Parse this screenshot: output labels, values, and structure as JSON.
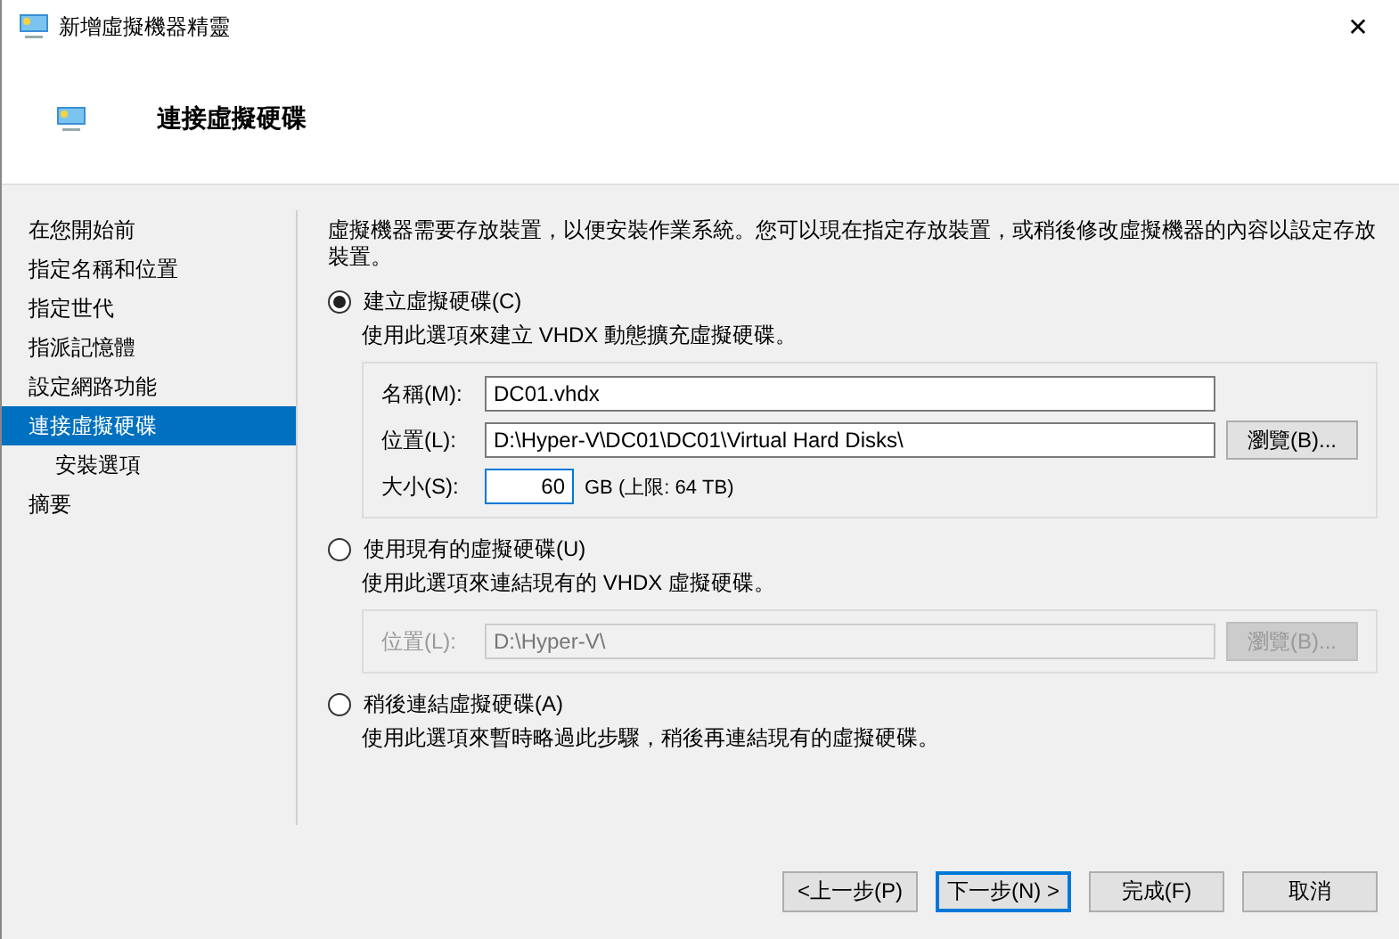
{
  "window": {
    "title": "新增虛擬機器精靈",
    "close": "✕"
  },
  "header": {
    "title": "連接虛擬硬碟"
  },
  "sidebar": {
    "items": [
      {
        "label": "在您開始前",
        "selected": false
      },
      {
        "label": "指定名稱和位置",
        "selected": false
      },
      {
        "label": "指定世代",
        "selected": false
      },
      {
        "label": "指派記憶體",
        "selected": false
      },
      {
        "label": "設定網路功能",
        "selected": false
      },
      {
        "label": "連接虛擬硬碟",
        "selected": true,
        "children": [
          {
            "label": "安裝選項",
            "selected": false
          }
        ]
      },
      {
        "label": "摘要",
        "selected": false
      }
    ]
  },
  "intro": "虛擬機器需要存放裝置，以便安裝作業系統。您可以現在指定存放裝置，或稍後修改虛擬機器的內容以設定存放裝置。",
  "options": [
    {
      "label": "建立虛擬硬碟(C)",
      "selected": true,
      "description": "使用此選項來建立 VHDX 動態擴充虛擬硬碟。",
      "group": {
        "disabled": false,
        "fields": [
          {
            "kind": "text",
            "label": "名稱(M):",
            "value": "DC01.vhdx"
          },
          {
            "kind": "path",
            "label": "位置(L):",
            "value": "D:\\Hyper-V\\DC01\\DC01\\Virtual Hard Disks\\",
            "button": "瀏覽(B)..."
          },
          {
            "kind": "size",
            "label": "大小(S):",
            "value": "60",
            "suffix": "GB (上限: 64 TB)"
          }
        ]
      }
    },
    {
      "label": "使用現有的虛擬硬碟(U)",
      "selected": false,
      "description": "使用此選項來連結現有的 VHDX 虛擬硬碟。",
      "group": {
        "disabled": true,
        "fields": [
          {
            "kind": "path",
            "label": "位置(L):",
            "value": "D:\\Hyper-V\\",
            "button": "瀏覽(B)..."
          }
        ]
      }
    },
    {
      "label": "稍後連結虛擬硬碟(A)",
      "selected": false,
      "description": "使用此選項來暫時略過此步驟，稍後再連結現有的虛擬硬碟。"
    }
  ],
  "buttons": [
    {
      "label": "<上一步(P)",
      "default": false
    },
    {
      "label": "下一步(N) >",
      "default": true
    },
    {
      "label": "完成(F)",
      "default": false
    },
    {
      "label": "取消",
      "default": false
    }
  ]
}
